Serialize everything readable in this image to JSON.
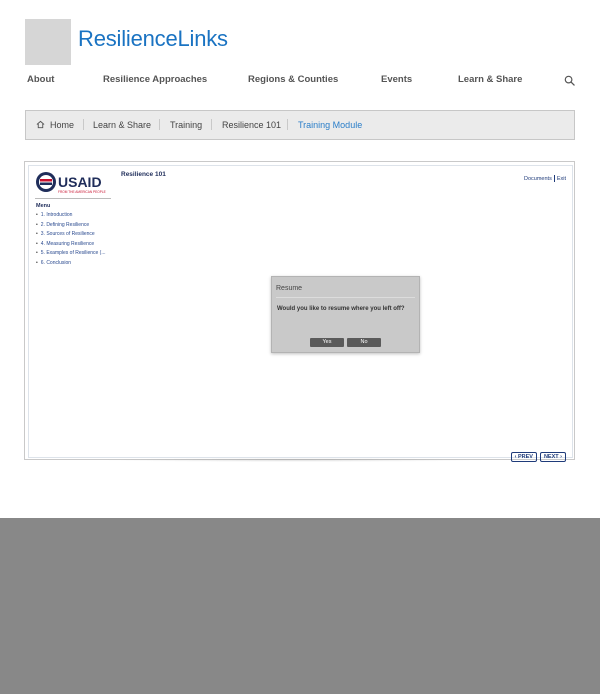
{
  "site": {
    "title": "ResilienceLinks"
  },
  "nav": {
    "items": [
      "About",
      "Resilience Approaches",
      "Regions & Counties",
      "Events",
      "Learn & Share"
    ],
    "search_icon": "search-icon"
  },
  "breadcrumb": {
    "home_icon": "home-icon",
    "items": [
      "Home",
      "Learn & Share",
      "Training",
      "Resilience 101",
      "Training Module"
    ],
    "active_index": 4,
    "active_color": "#2a7ec9"
  },
  "module": {
    "logo_text": "USAID",
    "logo_tagline": "FROM THE AMERICAN PEOPLE",
    "course_title": "Resilience 101",
    "links": {
      "documents": "Documents",
      "exit": "Exit"
    },
    "menu_title": "Menu",
    "menu_items": [
      "1. Introduction",
      "2. Defining Resilience",
      "3. Sources of Resilience",
      "4. Measuring Resilience",
      "5. Examples of Resilience (...",
      "6. Conclusion"
    ],
    "dialog": {
      "title": "Resume",
      "message": "Would you like to resume where you left off?",
      "yes": "Yes",
      "no": "No"
    },
    "prev": "PREV",
    "next": "NEXT"
  },
  "colors": {
    "brand_blue": "#1a73c2",
    "footer_gray": "#888888",
    "usaid_navy": "#1f2d5a",
    "usaid_red": "#c8102e"
  }
}
